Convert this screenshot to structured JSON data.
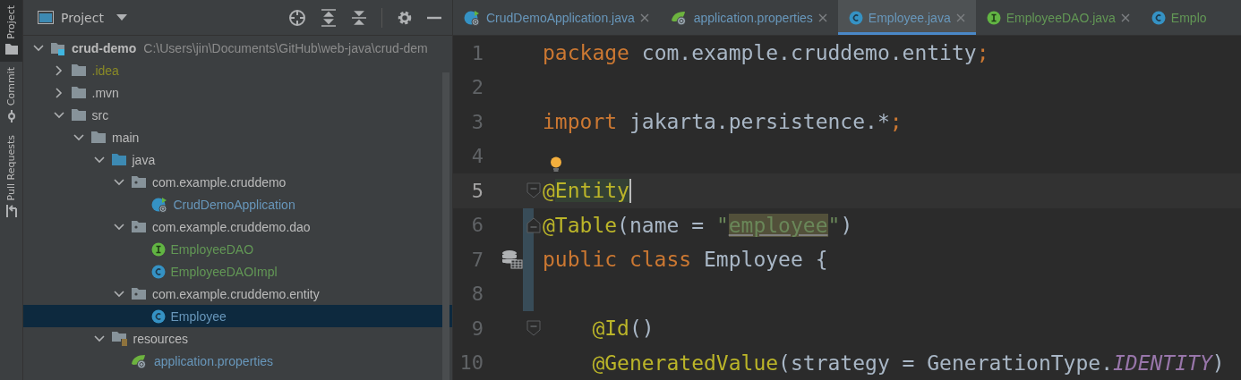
{
  "tool_strip": [
    {
      "label": "Project",
      "kind": "folder",
      "selected": true
    },
    {
      "label": "Commit",
      "kind": "commit",
      "selected": false
    },
    {
      "label": "Pull Requests",
      "kind": "pull",
      "selected": false
    }
  ],
  "project_panel": {
    "title": "Project",
    "tree": [
      {
        "name": "crud-demo",
        "path": "C:\\Users\\jin\\Documents\\GitHub\\web-java\\crud-dem",
        "kind": "module",
        "expanded": true,
        "selected": false,
        "color": "#bbbbbb",
        "children": [
          {
            "name": ".idea",
            "kind": "folder",
            "expanded": false,
            "selected": false,
            "color": "#8a8a26"
          },
          {
            "name": ".mvn",
            "kind": "folder",
            "expanded": false,
            "selected": false,
            "color": "#bbbbbb"
          },
          {
            "name": "src",
            "kind": "folder",
            "expanded": true,
            "selected": false,
            "color": "#bbbbbb",
            "children": [
              {
                "name": "main",
                "kind": "folder",
                "expanded": true,
                "selected": false,
                "color": "#bbbbbb",
                "children": [
                  {
                    "name": "java",
                    "kind": "source_folder",
                    "expanded": true,
                    "selected": false,
                    "color": "#bbbbbb",
                    "children": [
                      {
                        "name": "com.example.cruddemo",
                        "kind": "package",
                        "expanded": true,
                        "selected": false,
                        "color": "#bbbbbb",
                        "children": [
                          {
                            "name": "CrudDemoApplication",
                            "kind": "spring_class",
                            "selected": false,
                            "color": "#6897bb"
                          }
                        ]
                      },
                      {
                        "name": "com.example.cruddemo.dao",
                        "kind": "package",
                        "expanded": true,
                        "selected": false,
                        "color": "#bbbbbb",
                        "children": [
                          {
                            "name": "EmployeeDAO",
                            "kind": "interface",
                            "selected": false,
                            "color": "#629755"
                          },
                          {
                            "name": "EmployeeDAOImpl",
                            "kind": "class",
                            "selected": false,
                            "color": "#629755"
                          }
                        ]
                      },
                      {
                        "name": "com.example.cruddemo.entity",
                        "kind": "package",
                        "expanded": true,
                        "selected": false,
                        "color": "#bbbbbb",
                        "children": [
                          {
                            "name": "Employee",
                            "kind": "class",
                            "selected": true,
                            "color": "#6897bb"
                          }
                        ]
                      }
                    ]
                  },
                  {
                    "name": "resources",
                    "kind": "resources",
                    "expanded": true,
                    "selected": false,
                    "color": "#bbbbbb",
                    "children": [
                      {
                        "name": "application.properties",
                        "kind": "spring_props",
                        "selected": false,
                        "color": "#6897bb"
                      }
                    ]
                  }
                ]
              }
            ]
          }
        ]
      }
    ]
  },
  "editor_tabs": [
    {
      "label": "CrudDemoApplication.java",
      "kind": "spring_class",
      "selected": false,
      "closable": true,
      "color": "#6897bb"
    },
    {
      "label": "application.properties",
      "kind": "spring_props",
      "selected": false,
      "closable": true,
      "color": "#6897bb"
    },
    {
      "label": "Employee.java",
      "kind": "class",
      "selected": true,
      "closable": true,
      "color": "#6897bb"
    },
    {
      "label": "EmployeeDAO.java",
      "kind": "interface",
      "selected": false,
      "closable": true,
      "color": "#629755"
    },
    {
      "label": "Emplo",
      "kind": "class",
      "selected": false,
      "closable": false,
      "color": "#629755"
    }
  ],
  "code_lines": [
    {
      "number": "1",
      "current": false,
      "changed": false,
      "tokens": [
        {
          "kind": "keyword",
          "text": "package "
        },
        {
          "kind": "plain",
          "text": "com.example.cruddemo.entity"
        },
        {
          "kind": "keyword",
          "text": ";"
        }
      ]
    },
    {
      "number": "2",
      "current": false,
      "changed": false
    },
    {
      "number": "3",
      "current": false,
      "changed": false,
      "tokens": [
        {
          "kind": "keyword",
          "text": "import "
        },
        {
          "kind": "plain",
          "text": "jakarta.persistence.*"
        },
        {
          "kind": "keyword",
          "text": ";"
        }
      ]
    },
    {
      "number": "4",
      "current": false,
      "changed": false,
      "bulb": true
    },
    {
      "number": "5",
      "current": true,
      "changed": false,
      "fold_start": true,
      "tokens": [
        {
          "kind": "annotation",
          "text": "@"
        },
        {
          "kind": "annotation",
          "text": "Entity",
          "highlight": true
        }
      ]
    },
    {
      "number": "6",
      "current": false,
      "changed": true,
      "fold_end": true,
      "tokens": [
        {
          "kind": "annotation",
          "text": "@Table"
        },
        {
          "kind": "plain",
          "text": "(name = "
        },
        {
          "kind": "string",
          "text": "\""
        },
        {
          "kind": "string",
          "text": "employee",
          "highlight": true
        },
        {
          "kind": "string",
          "text": "\""
        },
        {
          "kind": "plain",
          "text": ")"
        }
      ]
    },
    {
      "number": "7",
      "current": false,
      "changed": true,
      "entity_marker": true,
      "tokens": [
        {
          "kind": "keyword",
          "text": "public class "
        },
        {
          "kind": "plain",
          "text": "Employee {"
        }
      ]
    },
    {
      "number": "8",
      "current": false,
      "changed": true
    },
    {
      "number": "9",
      "current": false,
      "changed": false,
      "fold_start": true,
      "tokens": [
        {
          "kind": "annotation",
          "text": "    @Id"
        },
        {
          "kind": "plain",
          "text": "()"
        }
      ]
    },
    {
      "number": "10",
      "current": false,
      "changed": false,
      "tokens": [
        {
          "kind": "annotation",
          "text": "    @GeneratedValue"
        },
        {
          "kind": "plain",
          "text": "(strategy = GenerationType."
        },
        {
          "kind": "constant",
          "text": "IDENTITY"
        },
        {
          "kind": "plain",
          "text": ")"
        }
      ]
    }
  ]
}
